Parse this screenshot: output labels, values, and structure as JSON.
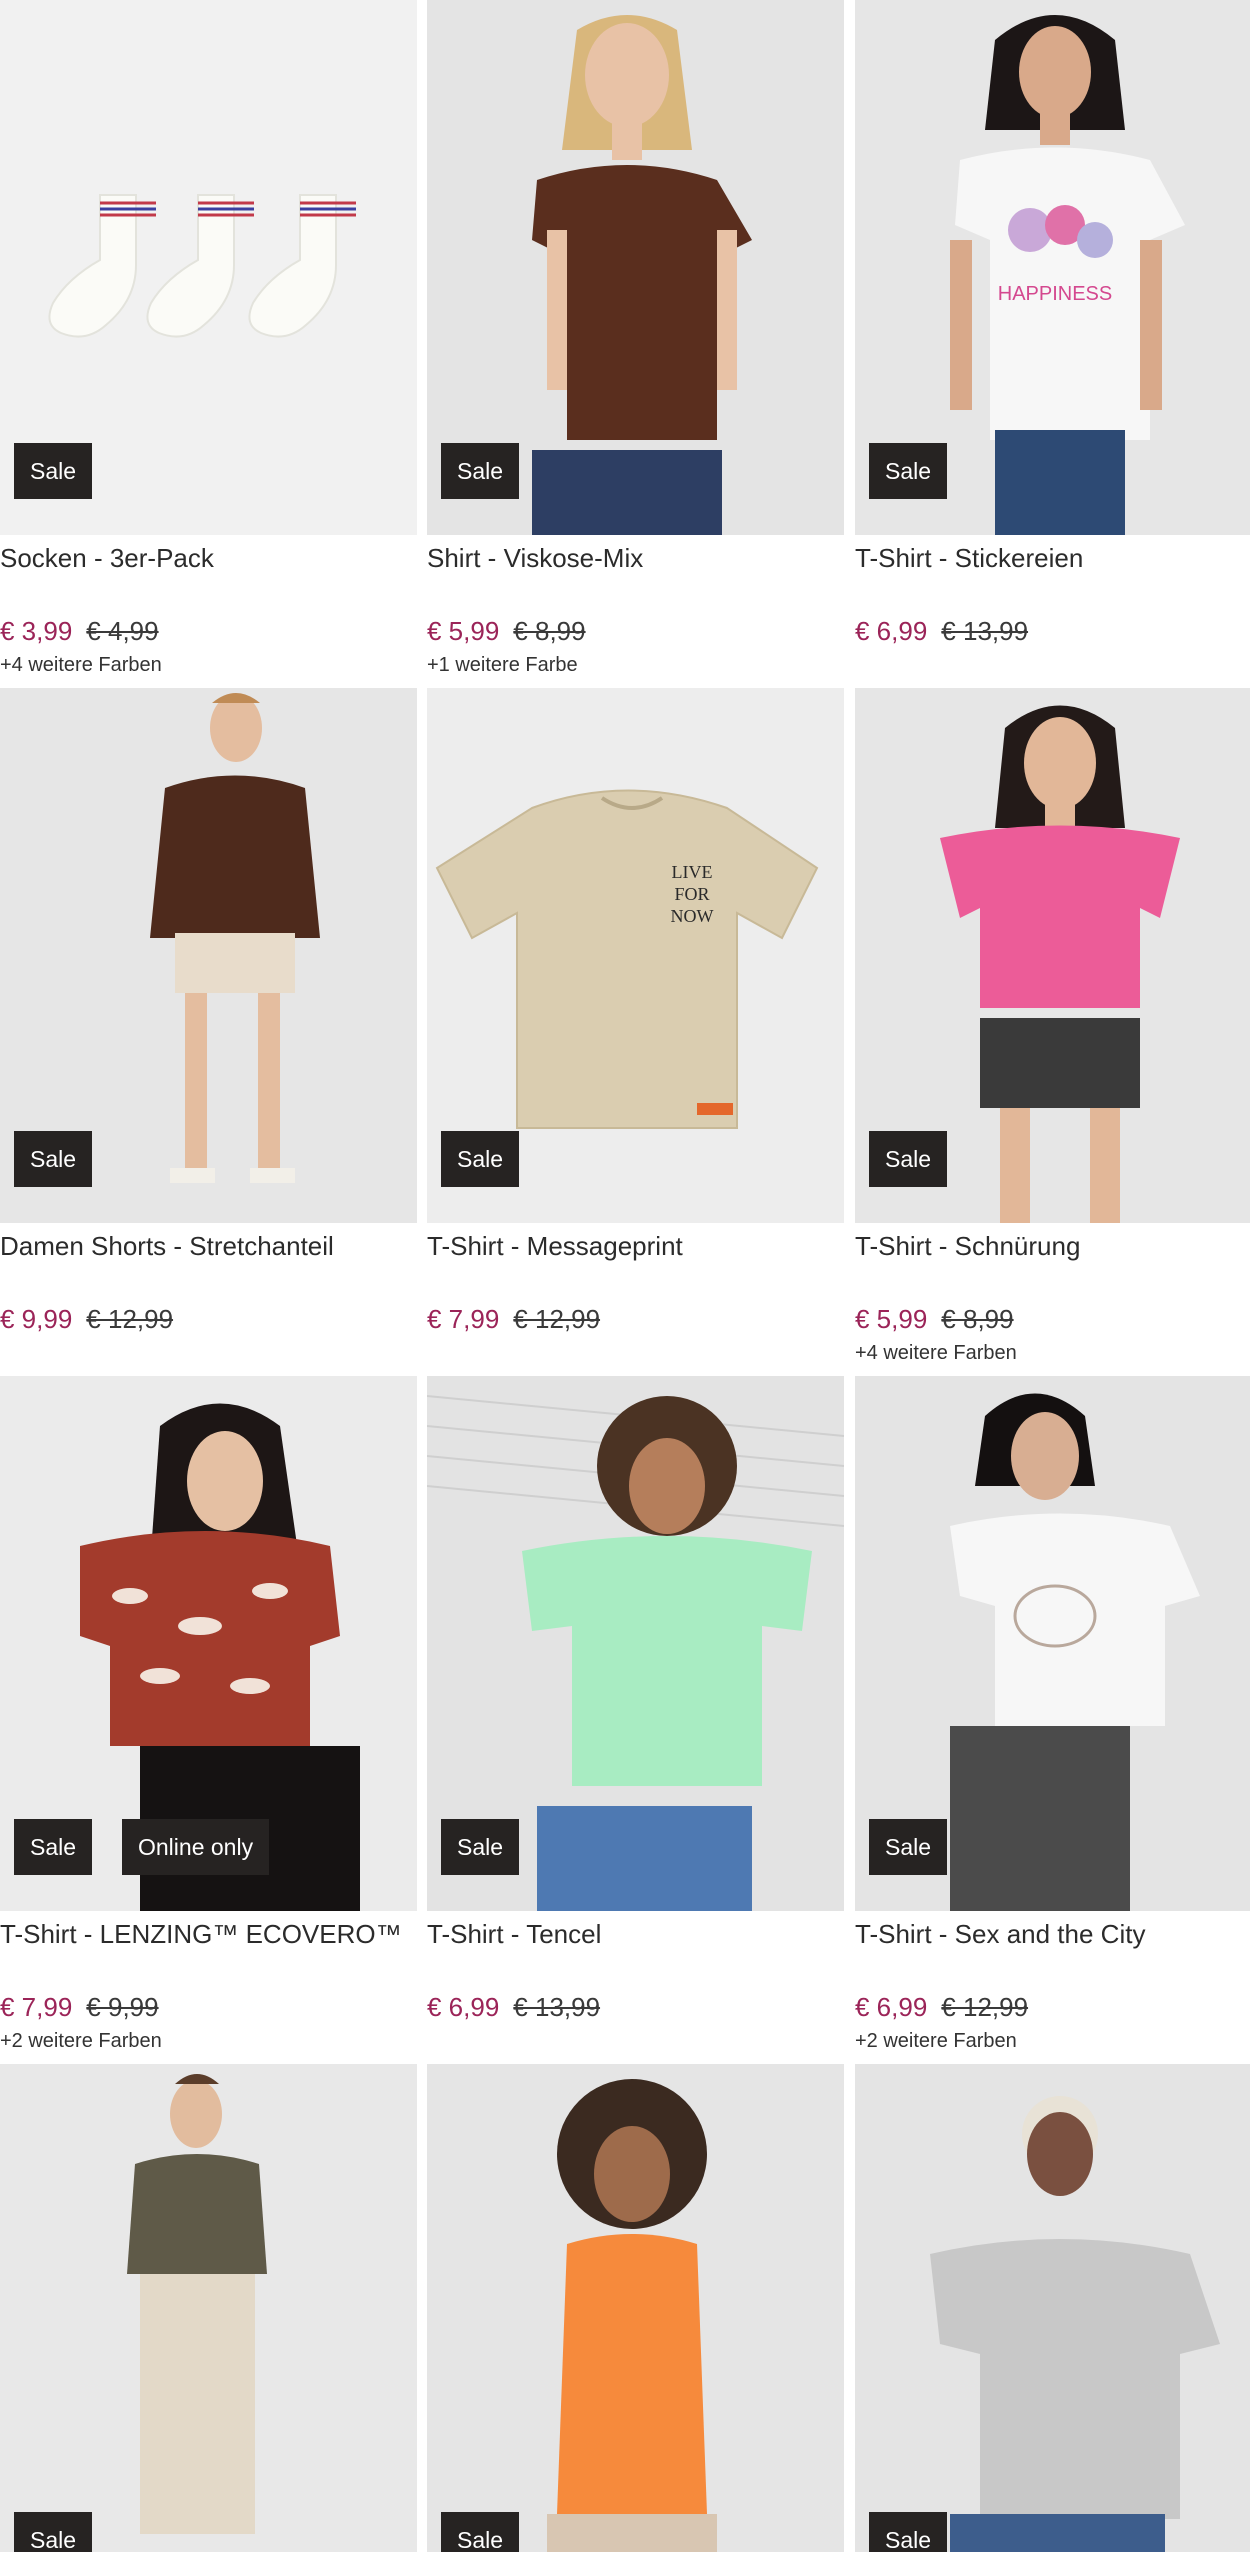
{
  "products": [
    {
      "title": "Socken - 3er-Pack",
      "price": "€ 3,99",
      "old_price": "€ 4,99",
      "colors": "+4 weitere Farben",
      "badges": [
        "Sale"
      ],
      "image": "socks-illustration"
    },
    {
      "title": "Shirt - Viskose-Mix",
      "price": "€ 5,99",
      "old_price": "€ 8,99",
      "colors": "+1 weitere Farbe",
      "badges": [
        "Sale"
      ],
      "image": "model-brown-shirt"
    },
    {
      "title": "T-Shirt - Stickereien",
      "price": "€ 6,99",
      "old_price": "€ 13,99",
      "colors": "",
      "badges": [
        "Sale"
      ],
      "image": "model-white-print-tee"
    },
    {
      "title": "Damen Shorts - Stretchanteil",
      "price": "€ 9,99",
      "old_price": "€ 12,99",
      "colors": "",
      "badges": [
        "Sale"
      ],
      "image": "model-brown-top-shorts"
    },
    {
      "title": "T-Shirt - Messageprint",
      "price": "€ 7,99",
      "old_price": "€ 12,99",
      "colors": "",
      "badges": [
        "Sale"
      ],
      "image": "beige-tee-flatlay"
    },
    {
      "title": "T-Shirt - Schnürung",
      "price": "€ 5,99",
      "old_price": "€ 8,99",
      "colors": "+4 weitere Farben",
      "badges": [
        "Sale"
      ],
      "image": "model-pink-tee"
    },
    {
      "title": "T-Shirt - LENZING™ ECOVERO™",
      "price": "€ 7,99",
      "old_price": "€ 9,99",
      "colors": "+2 weitere Farben",
      "badges": [
        "Sale",
        "Online only"
      ],
      "image": "model-red-pattern-top"
    },
    {
      "title": "T-Shirt - Tencel",
      "price": "€ 6,99",
      "old_price": "€ 13,99",
      "colors": "",
      "badges": [
        "Sale"
      ],
      "image": "model-mint-tee"
    },
    {
      "title": "T-Shirt - Sex and the City",
      "price": "€ 6,99",
      "old_price": "€ 12,99",
      "colors": "+2 weitere Farben",
      "badges": [
        "Sale"
      ],
      "image": "model-white-graphic-tee"
    },
    {
      "title": "",
      "price": "",
      "old_price": "",
      "colors": "",
      "badges": [
        "Sale"
      ],
      "image": "model-khaki-tee"
    },
    {
      "title": "",
      "price": "",
      "old_price": "",
      "colors": "",
      "badges": [
        "Sale"
      ],
      "image": "model-orange-tank"
    },
    {
      "title": "",
      "price": "",
      "old_price": "",
      "colors": "",
      "badges": [
        "Sale"
      ],
      "image": "model-grey-polo"
    }
  ],
  "colors": {
    "price": "#9b2458",
    "badge_bg": "#262322",
    "badge_text": "#ffffff"
  }
}
